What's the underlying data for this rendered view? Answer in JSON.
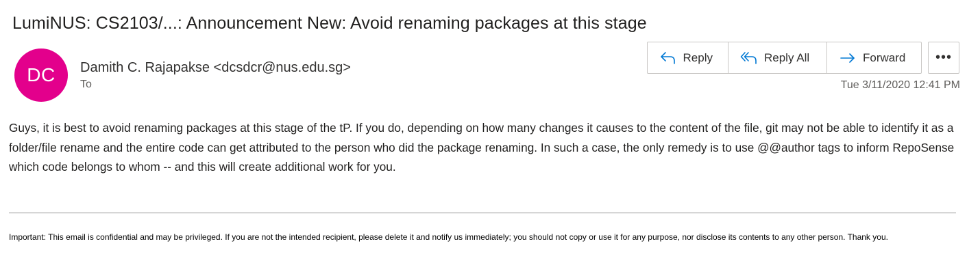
{
  "email": {
    "subject": "LumiNUS: CS2103/...: Announcement New: Avoid renaming packages at this stage",
    "avatar_initials": "DC",
    "sender": "Damith C. Rajapakse <dcsdcr@nus.edu.sg>",
    "to_label": "To",
    "timestamp": "Tue 3/11/2020 12:41 PM",
    "body": "Guys, it is best to avoid renaming packages at this stage of the tP. If you do, depending on how many changes it causes to the content of the file, git may not be able to identify it as a folder/file rename and the entire code can get attributed to the person who did the package renaming. In such a case, the only remedy is to use @@author tags to inform RepoSense which code belongs to whom -- and this will create additional work for you.",
    "disclaimer": "Important: This email is confidential and may be privileged. If you are not the intended recipient, please delete it and notify us immediately; you should not copy or use it for any purpose, nor disclose its contents to any other person. Thank you."
  },
  "actions": {
    "reply_label": "Reply",
    "reply_all_label": "Reply All",
    "forward_label": "Forward",
    "more_label": "•••"
  },
  "icons": {
    "reply": "reply-icon",
    "reply_all": "reply-all-icon",
    "forward": "forward-arrow-icon",
    "more": "more-ellipsis-icon"
  },
  "colors": {
    "avatar_bg": "#e3008c",
    "accent_blue": "#0078d4"
  }
}
